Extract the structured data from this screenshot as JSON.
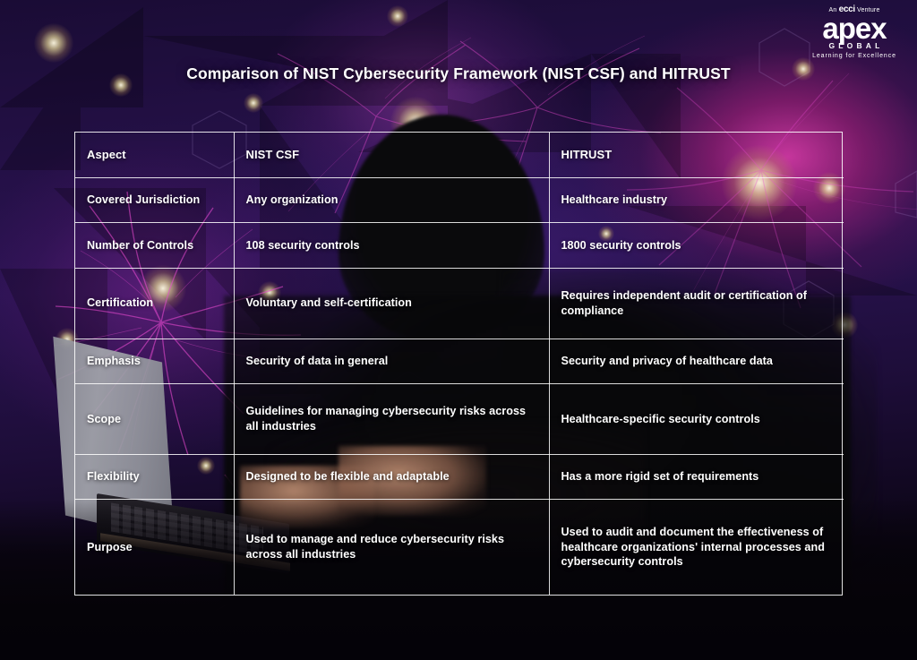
{
  "brand": {
    "venture_prefix": "An",
    "venture_name": "ecci",
    "venture_suffix": "Venture",
    "name": "apex",
    "sub": "GLOBAL",
    "tagline": "Learning for Excellence"
  },
  "title": "Comparison of NIST Cybersecurity Framework (NIST CSF) and HITRUST",
  "colors": {
    "accent_magenta": "#e13caa",
    "background_purple": "#2a1352",
    "text": "#ffffff",
    "table_border": "#ffffff"
  },
  "table": {
    "columns": [
      "Aspect",
      "NIST CSF",
      "HITRUST"
    ],
    "rows": [
      {
        "aspect": "Covered Jurisdiction",
        "nist_csf": "Any organization",
        "hitrust": "Healthcare industry"
      },
      {
        "aspect": "Number of Controls",
        "nist_csf": "108 security controls",
        "hitrust": "1800 security controls"
      },
      {
        "aspect": "Certification",
        "nist_csf": "Voluntary and self-certification",
        "hitrust": "Requires independent audit or certification of compliance"
      },
      {
        "aspect": "Emphasis",
        "nist_csf": "Security of data in general",
        "hitrust": "Security and privacy of healthcare data"
      },
      {
        "aspect": "Scope",
        "nist_csf": "Guidelines for managing cybersecurity risks across all industries",
        "hitrust": "Healthcare-specific security controls"
      },
      {
        "aspect": "Flexibility",
        "nist_csf": "Designed to be flexible and adaptable",
        "hitrust": "Has a more rigid set of requirements"
      },
      {
        "aspect": "Purpose",
        "nist_csf": "Used to manage and reduce cybersecurity risks across all industries",
        "hitrust": "Used to audit and document the effectiveness of healthcare organizations' internal processes and cybersecurity controls"
      }
    ]
  }
}
